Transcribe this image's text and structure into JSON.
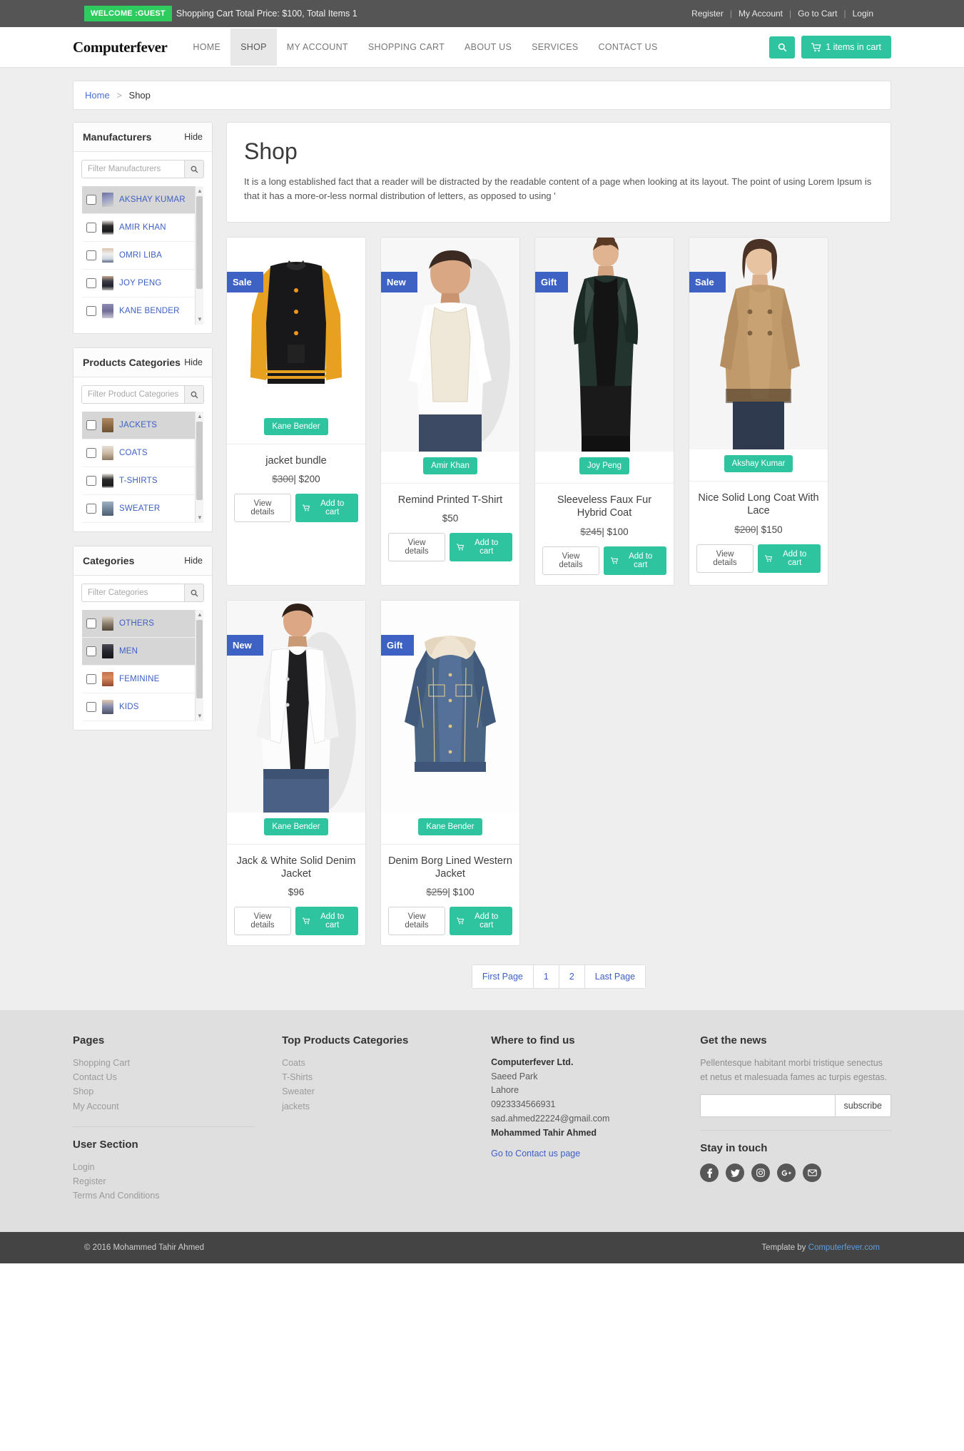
{
  "topbar": {
    "welcome_badge": "WELCOME :GUEST",
    "cart_summary": "Shopping Cart Total Price: $100, Total Items 1",
    "links": [
      "Register",
      "My Account",
      "Go to Cart",
      "Login"
    ],
    "separator": "|"
  },
  "nav": {
    "brand": "Computerfever",
    "items": [
      {
        "label": "HOME",
        "active": false
      },
      {
        "label": "SHOP",
        "active": true
      },
      {
        "label": "MY ACCOUNT",
        "active": false
      },
      {
        "label": "SHOPPING CART",
        "active": false
      },
      {
        "label": "ABOUT US",
        "active": false
      },
      {
        "label": "SERVICES",
        "active": false
      },
      {
        "label": "CONTACT US",
        "active": false
      }
    ],
    "search_icon": "search-icon",
    "cart_button": "1 items in cart",
    "cart_icon": "shopping-cart-icon"
  },
  "breadcrumb": {
    "home": "Home",
    "separator": ">",
    "current": "Shop"
  },
  "sidebar": {
    "panels": [
      {
        "title": "Manufacturers",
        "hide_label": "Hide",
        "filter_placeholder": "Filter Manufacturers",
        "filter_value": "",
        "options": [
          {
            "label": "AKSHAY KUMAR",
            "selected": true
          },
          {
            "label": "AMIR KHAN",
            "selected": false
          },
          {
            "label": "OMRI LIBA",
            "selected": false
          },
          {
            "label": "JOY PENG",
            "selected": false
          },
          {
            "label": "KANE BENDER",
            "selected": false
          }
        ]
      },
      {
        "title": "Products Categories",
        "hide_label": "Hide",
        "filter_placeholder": "Filter Product Categories",
        "filter_value": "",
        "options": [
          {
            "label": "JACKETS",
            "selected": true
          },
          {
            "label": "COATS",
            "selected": false
          },
          {
            "label": "T-SHIRTS",
            "selected": false
          },
          {
            "label": "SWEATER",
            "selected": false
          }
        ]
      },
      {
        "title": "Categories",
        "hide_label": "Hide",
        "filter_placeholder": "Filter Categories",
        "filter_value": "",
        "options": [
          {
            "label": "OTHERS",
            "selected": true
          },
          {
            "label": "MEN",
            "selected": true
          },
          {
            "label": "FEMININE",
            "selected": false
          },
          {
            "label": "KIDS",
            "selected": false
          }
        ]
      }
    ]
  },
  "shop": {
    "title": "Shop",
    "description": "It is a long established fact that a reader will be distracted by the readable content of a page when looking at its layout. The point of using Lorem Ipsum is that it has a more-or-less normal distribution of letters, as opposed to using '"
  },
  "products": [
    {
      "ribbon": "Sale",
      "manufacturer": "Kane Bender",
      "name": "jacket bundle",
      "old_price": "$300",
      "price": "$200",
      "view_label": "View details",
      "cart_label": "Add to cart"
    },
    {
      "ribbon": "New",
      "manufacturer": "Amir Khan",
      "name": "Remind Printed T-Shirt",
      "old_price": "",
      "price": "$50",
      "view_label": "View details",
      "cart_label": "Add to cart"
    },
    {
      "ribbon": "Gift",
      "manufacturer": "Joy Peng",
      "name": "Sleeveless Faux Fur Hybrid Coat",
      "old_price": "$245",
      "price": "$100",
      "view_label": "View details",
      "cart_label": "Add to cart"
    },
    {
      "ribbon": "Sale",
      "manufacturer": "Akshay Kumar",
      "name": "Nice Solid Long Coat With Lace",
      "old_price": "$200",
      "price": "$150",
      "view_label": "View details",
      "cart_label": "Add to cart"
    },
    {
      "ribbon": "New",
      "manufacturer": "Kane Bender",
      "name": "Jack & White Solid Denim Jacket",
      "old_price": "",
      "price": "$96",
      "view_label": "View details",
      "cart_label": "Add to cart"
    },
    {
      "ribbon": "Gift",
      "manufacturer": "Kane Bender",
      "name": "Denim Borg Lined Western Jacket",
      "old_price": "$259",
      "price": "$100",
      "view_label": "View details",
      "cart_label": "Add to cart"
    }
  ],
  "pagination": [
    "First Page",
    "1",
    "2",
    "Last Page"
  ],
  "footer": {
    "pages": {
      "heading": "Pages",
      "links": [
        "Shopping Cart",
        "Contact Us",
        "Shop",
        "My Account"
      ]
    },
    "user_section": {
      "heading": "User Section",
      "links": [
        "Login",
        "Register",
        "Terms And Conditions"
      ]
    },
    "top_categories": {
      "heading": "Top Products Categories",
      "links": [
        "Coats",
        "T-Shirts",
        "Sweater",
        "jackets"
      ]
    },
    "where": {
      "heading": "Where to find us",
      "company": "Computerfever Ltd.",
      "street": "Saeed Park",
      "city": "Lahore",
      "phone": "0923334566931",
      "email": "sad.ahmed22224@gmail.com",
      "person": "Mohammed Tahir Ahmed",
      "contact_link": "Go to Contact us page"
    },
    "news": {
      "heading": "Get the news",
      "description": "Pellentesque habitant morbi tristique senectus et netus et malesuada fames ac turpis egestas.",
      "input_value": "",
      "subscribe_label": "subscribe"
    },
    "touch": {
      "heading": "Stay in touch",
      "socials": [
        "facebook-icon",
        "twitter-icon",
        "instagram-icon",
        "google-plus-icon",
        "email-icon"
      ]
    }
  },
  "copyright": {
    "left": "© 2016 Mohammed Tahir Ahmed",
    "right_prefix": "Template by",
    "right_link": "Computerfever.com"
  },
  "colors": {
    "teal": "#2ec4a0",
    "ribbon_blue": "#3d62c4",
    "badge_green": "#2ecc5f",
    "topbar_gray": "#555555"
  }
}
